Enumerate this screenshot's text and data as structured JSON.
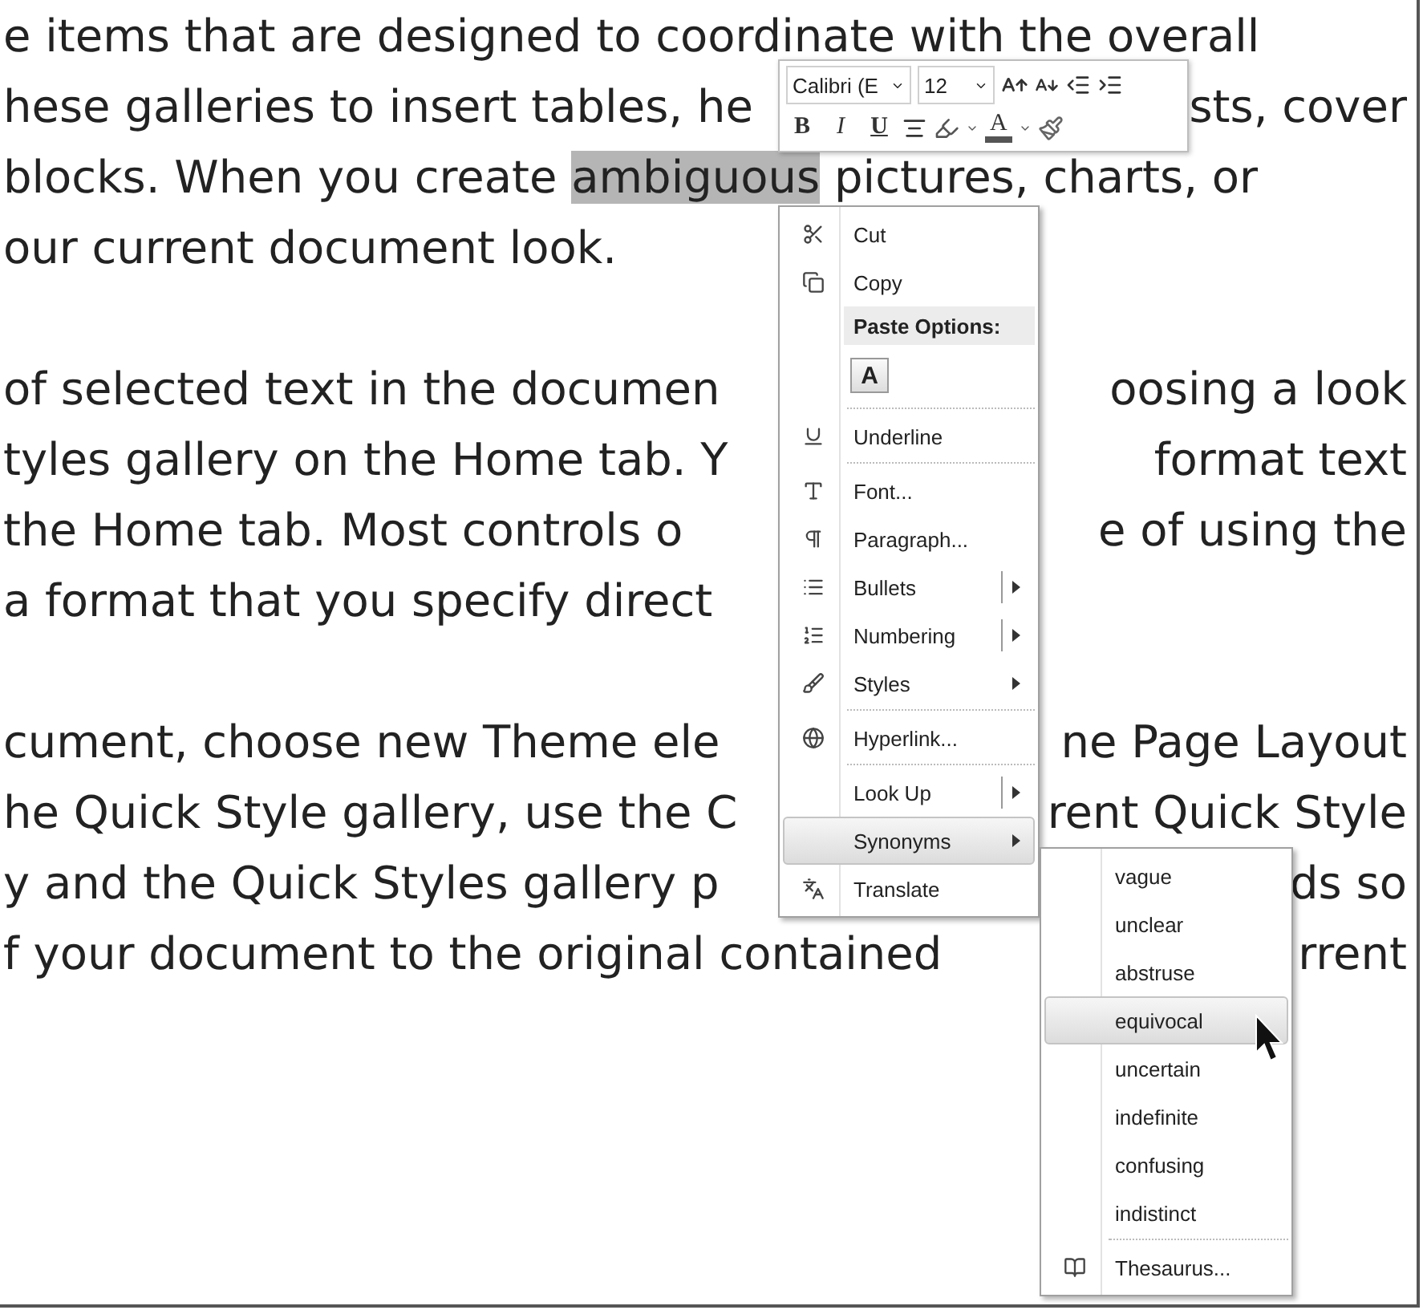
{
  "document": {
    "lines": [
      {
        "kind": "text",
        "left": "e items that are designed to coordinate with the overall"
      },
      {
        "left": "hese galleries to insert tables, he",
        "right": "sts, cover"
      },
      {
        "left": "blocks. When you create ",
        "selection": "ambiguous",
        "rest": " pictures, charts, or"
      },
      {
        "left": "our current document look."
      },
      {
        "kind": "blank"
      },
      {
        "left": "of selected text in the documen",
        "right": "oosing a look"
      },
      {
        "left": "tyles gallery on the Home tab. Y",
        "right": "format text"
      },
      {
        "left": "the Home tab. Most controls o",
        "right": "e of using the"
      },
      {
        "left": "a format that you specify direct"
      },
      {
        "kind": "blank"
      },
      {
        "left": "cument, choose new Theme ele",
        "right": "ne Page Layout"
      },
      {
        "left": "he Quick Style gallery, use the C",
        "right": "rent Quick Style"
      },
      {
        "left": "y and the Quick Styles gallery p",
        "right": "ds so"
      },
      {
        "left": "f your document to the original contained",
        "right": "rrent"
      }
    ]
  },
  "mini_toolbar": {
    "font": "Calibri (E",
    "size": "12",
    "bold": "B",
    "italic": "I",
    "underline": "U",
    "font_color": "A"
  },
  "context_menu": {
    "items": [
      {
        "kind": "command",
        "label": "Cut",
        "selected": false
      },
      {
        "kind": "command",
        "label": "Copy",
        "selected": false
      },
      {
        "kind": "header",
        "label": "Paste Options:"
      },
      {
        "kind": "paste",
        "label": "A"
      },
      {
        "kind": "separator"
      },
      {
        "kind": "command",
        "label": "Underline",
        "selected": false
      },
      {
        "kind": "separator"
      },
      {
        "kind": "command",
        "label": "Font...",
        "selected": false
      },
      {
        "kind": "command",
        "label": "Paragraph...",
        "selected": false
      },
      {
        "kind": "command",
        "label": "Bullets",
        "split": true,
        "submenu": true,
        "selected": false
      },
      {
        "kind": "command",
        "label": "Numbering",
        "split": true,
        "submenu": true,
        "selected": false
      },
      {
        "kind": "command",
        "label": "Styles",
        "submenu": true,
        "selected": false
      },
      {
        "kind": "separator"
      },
      {
        "kind": "command",
        "label": "Hyperlink...",
        "selected": false
      },
      {
        "kind": "separator"
      },
      {
        "kind": "command",
        "label": "Look Up",
        "split": true,
        "submenu": true,
        "selected": false
      },
      {
        "kind": "command",
        "label": "Synonyms",
        "submenu": true,
        "selected": true
      },
      {
        "kind": "command",
        "label": "Translate",
        "selected": false
      }
    ]
  },
  "synonyms_menu": {
    "items": [
      {
        "kind": "command",
        "label": "vague",
        "selected": false
      },
      {
        "kind": "command",
        "label": "unclear",
        "selected": false
      },
      {
        "kind": "command",
        "label": "abstruse",
        "selected": false
      },
      {
        "kind": "command",
        "label": "equivocal",
        "selected": true
      },
      {
        "kind": "command",
        "label": "uncertain",
        "selected": false
      },
      {
        "kind": "command",
        "label": "indefinite",
        "selected": false
      },
      {
        "kind": "command",
        "label": "confusing",
        "selected": false
      },
      {
        "kind": "command",
        "label": "indistinct",
        "selected": false
      },
      {
        "kind": "separator"
      },
      {
        "kind": "command",
        "label": "Thesaurus...",
        "selected": false
      }
    ]
  }
}
